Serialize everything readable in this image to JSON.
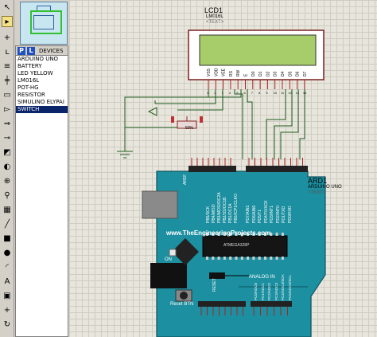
{
  "devices": {
    "mode_p": "P",
    "mode_l": "L",
    "header": "DEVICES",
    "items": [
      {
        "label": "ARDUINO UNO",
        "selected": false
      },
      {
        "label": "BATTERY",
        "selected": false
      },
      {
        "label": "LED YELLOW",
        "selected": false
      },
      {
        "label": "LM016L",
        "selected": false
      },
      {
        "label": "POT-HG",
        "selected": false
      },
      {
        "label": "RESISTOR",
        "selected": false
      },
      {
        "label": "SIMULINO ELYPAI",
        "selected": false
      },
      {
        "label": "SWITCH",
        "selected": true
      }
    ]
  },
  "lcd": {
    "ref": "LCD1",
    "model": "LM016L",
    "text": "<TEXT>",
    "pins": [
      "VSS",
      "VDD",
      "VEE",
      "RS",
      "RW",
      "E",
      "D0",
      "D1",
      "D2",
      "D3",
      "D4",
      "D5",
      "D6",
      "D7"
    ],
    "pin_numbers": [
      "1",
      "2",
      "3",
      "4",
      "5",
      "6",
      "7",
      "8",
      "9",
      "10",
      "11",
      "12",
      "13",
      "14"
    ]
  },
  "pot": {
    "label": "50%"
  },
  "arduino": {
    "ref": "ARD1",
    "model": "ARDUINO UNO",
    "text": "<TEXT>",
    "website": "www.TheEngineeringProjects.com",
    "aref": "AREF",
    "on_label": "ON",
    "reset_label": "RESET",
    "reset_btn": "Reset BTN",
    "analog_label": "ANALOG IN",
    "chip_label": "ATMEGA328P",
    "digital_pins": [
      "PB5/SCK",
      "PB4/MISO",
      "PB3/MOSI/OC2A",
      "PB2/SS/OC1B",
      "PB1/OC1A",
      "PB0/ICP1/CLKO",
      "PD7/AIN1",
      "PD6/AIN0",
      "PD5/T1",
      "PD4/T0/XCK",
      "PD3/INT1",
      "PD2/INT0",
      "PD1/TXD",
      "PD0/RXD"
    ],
    "analog_pins": [
      "PC0/ADC0",
      "PC1/ADC1",
      "PC2/ADC2",
      "PC3/ADC3",
      "PC4/ADC4/SDA",
      "PC5/ADC5/SCL"
    ]
  },
  "colors": {
    "board": "#1c8fa0",
    "lcd_screen": "#a6cd6a",
    "wire": "#1e5c1e",
    "pin_red": "#b02020"
  },
  "tools": [
    "select-icon",
    "component-icon",
    "junction-icon",
    "label-icon",
    "text-icon",
    "bus-icon",
    "subcircuit-icon",
    "terminal-icon",
    "port-icon",
    "graph-icon",
    "tape-icon",
    "generator-icon",
    "probe-icon",
    "instrument-icon",
    "line-icon",
    "box-icon",
    "circle-icon",
    "arc-icon",
    "path-icon",
    "text-a-icon",
    "symbol-icon",
    "marker-icon",
    "rotate-icon",
    "mirror-icon"
  ]
}
